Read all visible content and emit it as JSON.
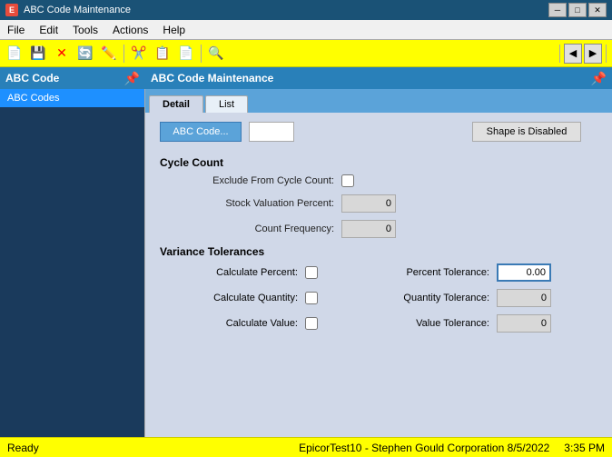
{
  "titleBar": {
    "title": "ABC Code Maintenance",
    "iconLabel": "E",
    "minimizeLabel": "─",
    "maximizeLabel": "□",
    "closeLabel": "✕"
  },
  "menuBar": {
    "items": [
      "File",
      "Edit",
      "Tools",
      "Actions",
      "Help"
    ]
  },
  "toolbar": {
    "buttons": [
      {
        "icon": "💾",
        "name": "save"
      },
      {
        "icon": "✕",
        "name": "cancel",
        "color": "red"
      },
      {
        "icon": "🔄",
        "name": "refresh"
      },
      {
        "icon": "✏️",
        "name": "edit"
      },
      {
        "icon": "✂️",
        "name": "cut"
      },
      {
        "icon": "📋",
        "name": "copy"
      },
      {
        "icon": "📄",
        "name": "paste"
      },
      {
        "icon": "🔍",
        "name": "search"
      }
    ],
    "navButtons": [
      "◀",
      "▶"
    ]
  },
  "leftPanel": {
    "title": "ABC Code",
    "pinIcon": "📌",
    "items": [
      "ABC Codes"
    ]
  },
  "contentPanel": {
    "title": "ABC Code Maintenance",
    "pinIcon": "📌",
    "tabs": [
      {
        "label": "Detail",
        "active": true
      },
      {
        "label": "List",
        "active": false
      }
    ]
  },
  "form": {
    "abcCodeButton": "ABC Code...",
    "abcCodeInput": "",
    "shapeDisabledButton": "Shape is Disabled",
    "cycleCount": {
      "sectionLabel": "Cycle Count",
      "excludeLabel": "Exclude From Cycle Count:",
      "excludeChecked": false,
      "stockValuationLabel": "Stock Valuation Percent:",
      "stockValuationValue": "0",
      "countFrequencyLabel": "Count Frequency:",
      "countFrequencyValue": "0"
    },
    "varianceTolerances": {
      "sectionLabel": "Variance Tolerances",
      "calculatePercentLabel": "Calculate Percent:",
      "calculatePercentChecked": false,
      "percentToleranceLabel": "Percent Tolerance:",
      "percentToleranceValue": "0.00",
      "calculateQuantityLabel": "Calculate Quantity:",
      "calculateQuantityChecked": false,
      "quantityToleranceLabel": "Quantity Tolerance:",
      "quantityToleranceValue": "0",
      "calculateValueLabel": "Calculate Value:",
      "calculateValueChecked": false,
      "valueToleranceLabel": "Value Tolerance:",
      "valueToleranceValue": "0"
    }
  },
  "statusBar": {
    "status": "Ready",
    "info": "EpicorTest10 - Stephen Gould Corporation  8/5/2022",
    "time": "3:35 PM"
  }
}
